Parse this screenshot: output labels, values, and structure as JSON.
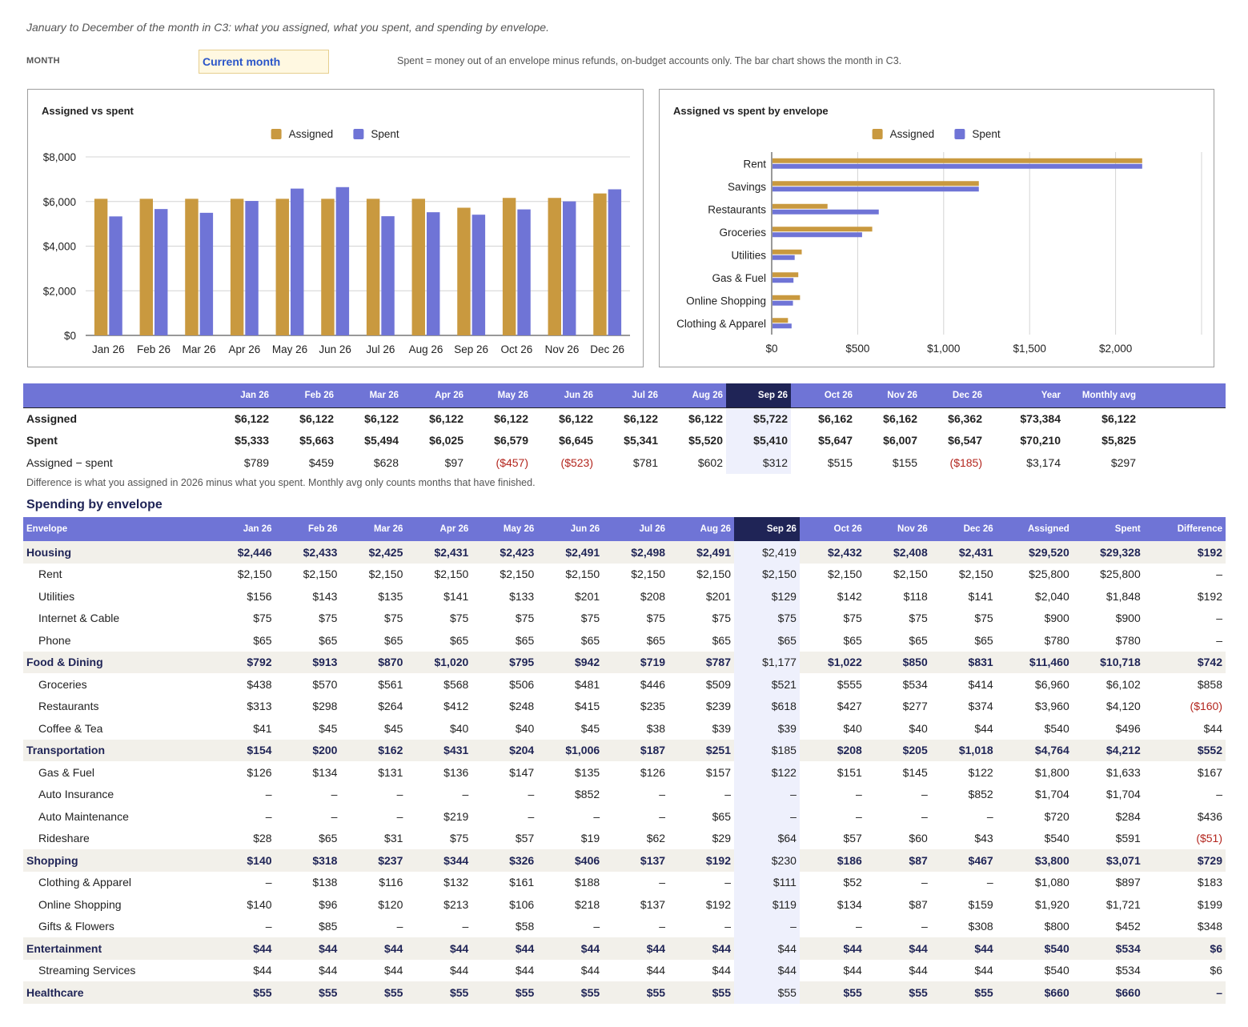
{
  "header": {
    "subtitle": "January to December of the month in C3: what you assigned, what you spent, and spending by envelope.",
    "month_label": "MONTH",
    "month_value": "Current month",
    "note": "Spent = money out of an envelope minus refunds, on-budget accounts only. The bar chart shows the month in C3."
  },
  "colors": {
    "assigned": "#c9993f",
    "spent": "#6f74d6",
    "header": "#6f74d6",
    "current": "#1f2456",
    "negative": "#b3261e"
  },
  "chart_data": [
    {
      "type": "bar",
      "title": "Assigned vs spent",
      "legend_position": "top",
      "categories": [
        "Jan 26",
        "Feb 26",
        "Mar 26",
        "Apr 26",
        "May 26",
        "Jun 26",
        "Jul 26",
        "Aug 26",
        "Sep 26",
        "Oct 26",
        "Nov 26",
        "Dec 26"
      ],
      "series": [
        {
          "name": "Assigned",
          "values": [
            6122,
            6122,
            6122,
            6122,
            6122,
            6122,
            6122,
            6122,
            5722,
            6162,
            6162,
            6362
          ]
        },
        {
          "name": "Spent",
          "values": [
            5333,
            5663,
            5494,
            6025,
            6579,
            6645,
            5341,
            5520,
            5410,
            5647,
            6007,
            6547
          ]
        }
      ],
      "ylim": [
        0,
        8000
      ],
      "yticks": [
        0,
        2000,
        4000,
        6000,
        8000
      ],
      "ytick_labels": [
        "$0",
        "$2,000",
        "$4,000",
        "$6,000",
        "$8,000"
      ],
      "grid": true
    },
    {
      "type": "bar",
      "orientation": "horizontal",
      "title": "Assigned vs spent by envelope",
      "legend_position": "top",
      "categories": [
        "Rent",
        "Savings",
        "Restaurants",
        "Groceries",
        "Utilities",
        "Gas & Fuel",
        "Online Shopping",
        "Clothing & Apparel"
      ],
      "series": [
        {
          "name": "Assigned",
          "values": [
            2150,
            1200,
            320,
            580,
            170,
            150,
            160,
            90
          ]
        },
        {
          "name": "Spent",
          "values": [
            2150,
            1200,
            618,
            521,
            129,
            122,
            119,
            111
          ]
        }
      ],
      "xlim": [
        0,
        2500
      ],
      "xticks": [
        0,
        500,
        1000,
        1500,
        2000
      ],
      "xtick_labels": [
        "$0",
        "$500",
        "$1,000",
        "$1,500",
        "$2,000"
      ],
      "grid": true
    }
  ],
  "summary": {
    "columns": [
      "",
      "Jan 26",
      "Feb 26",
      "Mar 26",
      "Apr 26",
      "May 26",
      "Jun 26",
      "Jul 26",
      "Aug 26",
      "Sep 26",
      "Oct 26",
      "Nov 26",
      "Dec 26",
      "Year",
      "Monthly avg"
    ],
    "current_index": 9,
    "rows": [
      {
        "label": "Assigned",
        "style": "bold",
        "cells": [
          "$6,122",
          "$6,122",
          "$6,122",
          "$6,122",
          "$6,122",
          "$6,122",
          "$6,122",
          "$6,122",
          "$5,722",
          "$6,162",
          "$6,162",
          "$6,362",
          "$73,384",
          "$6,122"
        ]
      },
      {
        "label": "Spent",
        "style": "bold",
        "cells": [
          "$5,333",
          "$5,663",
          "$5,494",
          "$6,025",
          "$6,579",
          "$6,645",
          "$5,341",
          "$5,520",
          "$5,410",
          "$5,647",
          "$6,007",
          "$6,547",
          "$70,210",
          "$5,825"
        ]
      },
      {
        "label": "Assigned − spent",
        "style": "normal",
        "cells": [
          "$789",
          "$459",
          "$628",
          "$97",
          "($457)",
          "($523)",
          "$781",
          "$602",
          "$312",
          "$515",
          "$155",
          "($185)",
          "$3,174",
          "$297"
        ]
      }
    ],
    "footnote": "Difference is what you assigned in 2026 minus what you spent. Monthly avg only counts months that have finished."
  },
  "envelopes": {
    "section_title": "Spending by envelope",
    "columns": [
      "Envelope",
      "Jan 26",
      "Feb 26",
      "Mar 26",
      "Apr 26",
      "May 26",
      "Jun 26",
      "Jul 26",
      "Aug 26",
      "Sep 26",
      "Oct 26",
      "Nov 26",
      "Dec 26",
      "Assigned",
      "Spent",
      "Difference"
    ],
    "current_index": 9,
    "rows": [
      {
        "label": "Housing",
        "group": true,
        "cells": [
          "$2,446",
          "$2,433",
          "$2,425",
          "$2,431",
          "$2,423",
          "$2,491",
          "$2,498",
          "$2,491",
          "$2,419",
          "$2,432",
          "$2,408",
          "$2,431",
          "$29,520",
          "$29,328",
          "$192"
        ]
      },
      {
        "label": "Rent",
        "group": false,
        "cells": [
          "$2,150",
          "$2,150",
          "$2,150",
          "$2,150",
          "$2,150",
          "$2,150",
          "$2,150",
          "$2,150",
          "$2,150",
          "$2,150",
          "$2,150",
          "$2,150",
          "$25,800",
          "$25,800",
          "–"
        ]
      },
      {
        "label": "Utilities",
        "group": false,
        "cells": [
          "$156",
          "$143",
          "$135",
          "$141",
          "$133",
          "$201",
          "$208",
          "$201",
          "$129",
          "$142",
          "$118",
          "$141",
          "$2,040",
          "$1,848",
          "$192"
        ]
      },
      {
        "label": "Internet & Cable",
        "group": false,
        "cells": [
          "$75",
          "$75",
          "$75",
          "$75",
          "$75",
          "$75",
          "$75",
          "$75",
          "$75",
          "$75",
          "$75",
          "$75",
          "$900",
          "$900",
          "–"
        ]
      },
      {
        "label": "Phone",
        "group": false,
        "cells": [
          "$65",
          "$65",
          "$65",
          "$65",
          "$65",
          "$65",
          "$65",
          "$65",
          "$65",
          "$65",
          "$65",
          "$65",
          "$780",
          "$780",
          "–"
        ]
      },
      {
        "label": "Food & Dining",
        "group": true,
        "cells": [
          "$792",
          "$913",
          "$870",
          "$1,020",
          "$795",
          "$942",
          "$719",
          "$787",
          "$1,177",
          "$1,022",
          "$850",
          "$831",
          "$11,460",
          "$10,718",
          "$742"
        ]
      },
      {
        "label": "Groceries",
        "group": false,
        "cells": [
          "$438",
          "$570",
          "$561",
          "$568",
          "$506",
          "$481",
          "$446",
          "$509",
          "$521",
          "$555",
          "$534",
          "$414",
          "$6,960",
          "$6,102",
          "$858"
        ]
      },
      {
        "label": "Restaurants",
        "group": false,
        "cells": [
          "$313",
          "$298",
          "$264",
          "$412",
          "$248",
          "$415",
          "$235",
          "$239",
          "$618",
          "$427",
          "$277",
          "$374",
          "$3,960",
          "$4,120",
          "($160)"
        ]
      },
      {
        "label": "Coffee & Tea",
        "group": false,
        "cells": [
          "$41",
          "$45",
          "$45",
          "$40",
          "$40",
          "$45",
          "$38",
          "$39",
          "$39",
          "$40",
          "$40",
          "$44",
          "$540",
          "$496",
          "$44"
        ]
      },
      {
        "label": "Transportation",
        "group": true,
        "cells": [
          "$154",
          "$200",
          "$162",
          "$431",
          "$204",
          "$1,006",
          "$187",
          "$251",
          "$185",
          "$208",
          "$205",
          "$1,018",
          "$4,764",
          "$4,212",
          "$552"
        ]
      },
      {
        "label": "Gas & Fuel",
        "group": false,
        "cells": [
          "$126",
          "$134",
          "$131",
          "$136",
          "$147",
          "$135",
          "$126",
          "$157",
          "$122",
          "$151",
          "$145",
          "$122",
          "$1,800",
          "$1,633",
          "$167"
        ]
      },
      {
        "label": "Auto Insurance",
        "group": false,
        "cells": [
          "–",
          "–",
          "–",
          "–",
          "–",
          "$852",
          "–",
          "–",
          "–",
          "–",
          "–",
          "$852",
          "$1,704",
          "$1,704",
          "–"
        ]
      },
      {
        "label": "Auto Maintenance",
        "group": false,
        "cells": [
          "–",
          "–",
          "–",
          "$219",
          "–",
          "–",
          "–",
          "$65",
          "–",
          "–",
          "–",
          "–",
          "$720",
          "$284",
          "$436"
        ]
      },
      {
        "label": "Rideshare",
        "group": false,
        "cells": [
          "$28",
          "$65",
          "$31",
          "$75",
          "$57",
          "$19",
          "$62",
          "$29",
          "$64",
          "$57",
          "$60",
          "$43",
          "$540",
          "$591",
          "($51)"
        ]
      },
      {
        "label": "Shopping",
        "group": true,
        "cells": [
          "$140",
          "$318",
          "$237",
          "$344",
          "$326",
          "$406",
          "$137",
          "$192",
          "$230",
          "$186",
          "$87",
          "$467",
          "$3,800",
          "$3,071",
          "$729"
        ]
      },
      {
        "label": "Clothing & Apparel",
        "group": false,
        "cells": [
          "–",
          "$138",
          "$116",
          "$132",
          "$161",
          "$188",
          "–",
          "–",
          "$111",
          "$52",
          "–",
          "–",
          "$1,080",
          "$897",
          "$183"
        ]
      },
      {
        "label": "Online Shopping",
        "group": false,
        "cells": [
          "$140",
          "$96",
          "$120",
          "$213",
          "$106",
          "$218",
          "$137",
          "$192",
          "$119",
          "$134",
          "$87",
          "$159",
          "$1,920",
          "$1,721",
          "$199"
        ]
      },
      {
        "label": "Gifts & Flowers",
        "group": false,
        "cells": [
          "–",
          "$85",
          "–",
          "–",
          "$58",
          "–",
          "–",
          "–",
          "–",
          "–",
          "–",
          "$308",
          "$800",
          "$452",
          "$348"
        ]
      },
      {
        "label": "Entertainment",
        "group": true,
        "cells": [
          "$44",
          "$44",
          "$44",
          "$44",
          "$44",
          "$44",
          "$44",
          "$44",
          "$44",
          "$44",
          "$44",
          "$44",
          "$540",
          "$534",
          "$6"
        ]
      },
      {
        "label": "Streaming Services",
        "group": false,
        "cells": [
          "$44",
          "$44",
          "$44",
          "$44",
          "$44",
          "$44",
          "$44",
          "$44",
          "$44",
          "$44",
          "$44",
          "$44",
          "$540",
          "$534",
          "$6"
        ]
      },
      {
        "label": "Healthcare",
        "group": true,
        "cells": [
          "$55",
          "$55",
          "$55",
          "$55",
          "$55",
          "$55",
          "$55",
          "$55",
          "$55",
          "$55",
          "$55",
          "$55",
          "$660",
          "$660",
          "–"
        ]
      }
    ]
  }
}
